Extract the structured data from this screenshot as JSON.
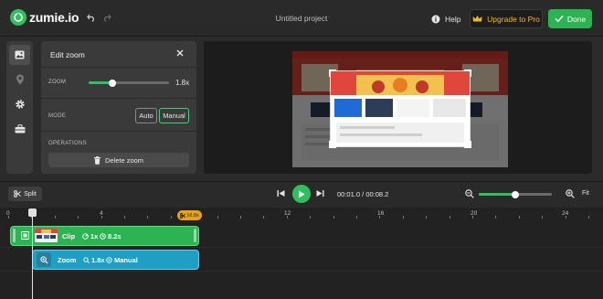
{
  "app": {
    "brand": "zumie.io",
    "project_title": "Untitled project",
    "help_label": "Help",
    "upgrade_label": "Upgrade to Pro",
    "done_label": "Done",
    "colors": {
      "accent_green": "#2cb452",
      "upgrade_gold": "#f2b824",
      "zoom_track_blue": "#1f9fc4",
      "badge_orange": "#e8a21a"
    }
  },
  "toolrail": {
    "items": [
      {
        "icon": "image-icon",
        "active": true
      },
      {
        "icon": "map-pin-icon",
        "active": false
      },
      {
        "icon": "gear-icon",
        "active": false
      },
      {
        "icon": "toolbox-icon",
        "active": false
      }
    ]
  },
  "zoom_panel": {
    "title": "Edit zoom",
    "zoom_label": "ZOOM",
    "zoom_value": "1.8x",
    "zoom_slider_level": 0.3,
    "mode_label": "MODE",
    "mode_options": [
      "Auto",
      "Manual"
    ],
    "mode_selected": "Manual",
    "operations_label": "OPERATIONS",
    "delete_label": "Delete zoom"
  },
  "transport": {
    "split_label": "Split",
    "current_time": "00:01.0",
    "separator": "/",
    "total_time": "00:08.2",
    "timeline_zoom_level": 0.5,
    "fit_label": "Fit"
  },
  "ruler": {
    "ticks": [
      "0",
      "4",
      "8",
      "12",
      "16",
      "20",
      "24"
    ],
    "badge": "16.8s"
  },
  "tracks": {
    "clip": {
      "label": "Clip",
      "speed": "1x",
      "duration": "8.2s"
    },
    "zoom": {
      "label": "Zoom",
      "level": "1.8x",
      "mode": "Manual"
    }
  }
}
